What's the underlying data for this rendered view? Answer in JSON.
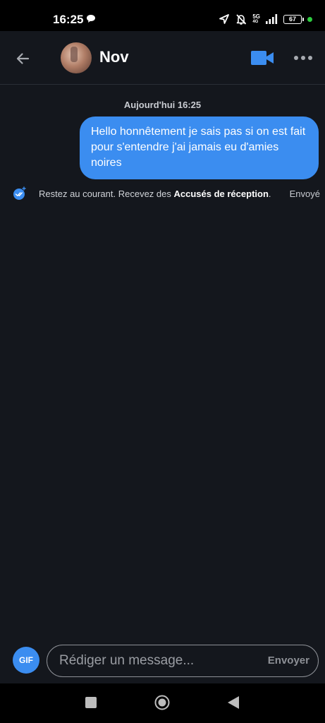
{
  "status_bar": {
    "time": "16:25",
    "network": "5G",
    "network_sub": "4G",
    "battery": "67",
    "icons": [
      "chat-bubble-icon",
      "location-arrow-icon",
      "bell-off-icon",
      "signal-icon",
      "battery-icon",
      "charging-dot-icon"
    ]
  },
  "header": {
    "back_icon": "arrow-left-icon",
    "contact_name": "Nov",
    "video_icon": "video-camera-icon",
    "more_icon": "more-horizontal-icon"
  },
  "conversation": {
    "date_separator": "Aujourd'hui 16:25",
    "messages": [
      {
        "direction": "outgoing",
        "text": "Hello honnêtement je sais pas si on est fait pour s'entendre j'ai jamais eu d'amies noires"
      }
    ],
    "receipt_prompt": {
      "icon": "read-receipt-icon",
      "text_prefix": "Restez au courant. Recevez des ",
      "text_bold": "Accusés de réception",
      "text_suffix": "."
    },
    "sent_status": "Envoyé"
  },
  "composer": {
    "gif_label": "GIF",
    "placeholder": "Rédiger un message...",
    "value": "",
    "send_label": "Envoyer"
  },
  "nav_bar": {
    "icons": [
      "recents-square-icon",
      "home-circle-icon",
      "back-triangle-icon"
    ]
  },
  "colors": {
    "accent": "#3b8df0",
    "background": "#14171d",
    "bubble": "#3b8df0"
  }
}
